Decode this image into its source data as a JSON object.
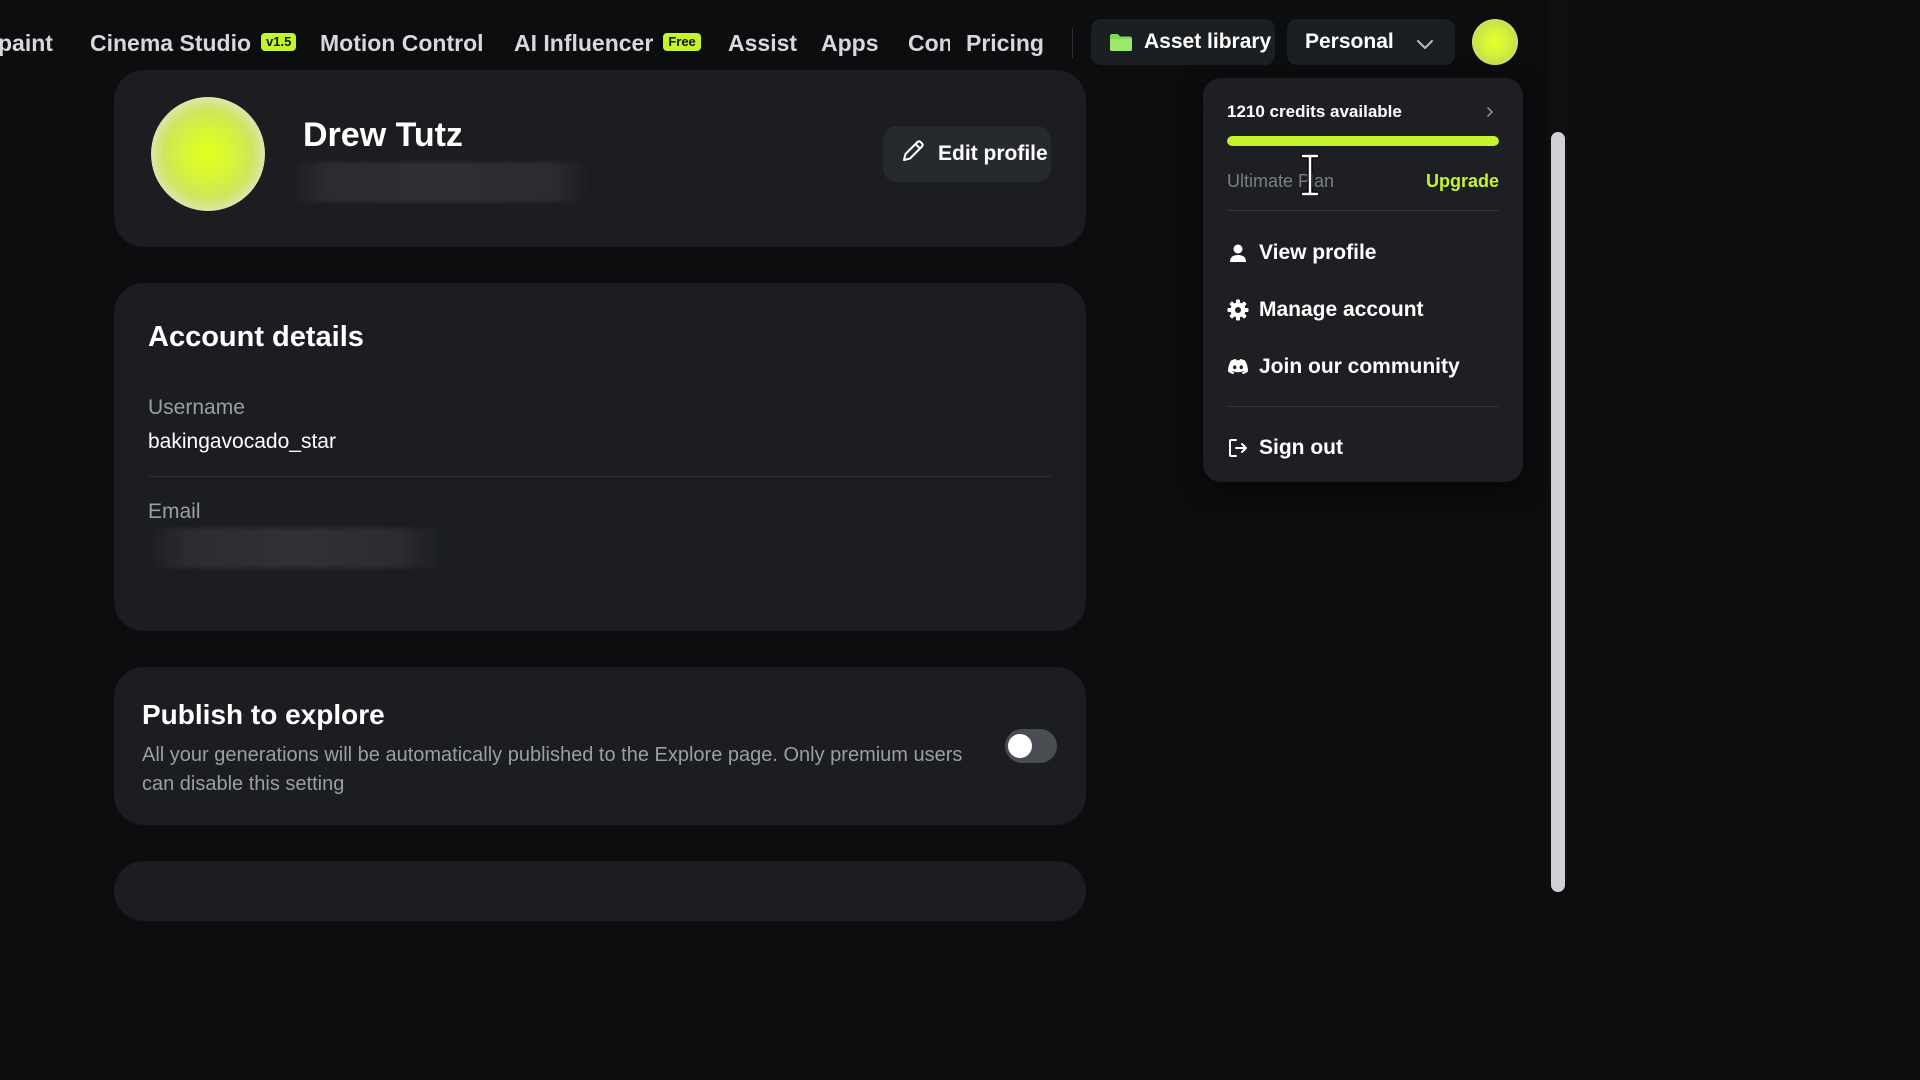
{
  "nav": {
    "items": [
      {
        "label": "paint",
        "badge": ""
      },
      {
        "label": "Cinema Studio",
        "badge": "v1.5"
      },
      {
        "label": "Motion Control",
        "badge": ""
      },
      {
        "label": "AI Influencer",
        "badge": "Free"
      },
      {
        "label": "Assist",
        "badge": ""
      },
      {
        "label": "Apps",
        "badge": ""
      },
      {
        "label": "Con",
        "badge": ""
      },
      {
        "label": "Pricing",
        "badge": ""
      }
    ],
    "asset_library_label": "Asset library",
    "asset_library_icon": "folder-icon",
    "workspace_selected": "Personal"
  },
  "profile": {
    "name": "Drew Tutz",
    "edit_label": "Edit profile"
  },
  "account": {
    "title": "Account details",
    "username_label": "Username",
    "username_value": "bakingavocado_star",
    "email_label": "Email"
  },
  "publish": {
    "title": "Publish to explore",
    "description": "All your generations will be automatically published to the Explore page. Only premium users can disable this setting",
    "enabled": false
  },
  "menu": {
    "credits_text": "1210 credits available",
    "credits_progress": 1.0,
    "plan_label": "Ultimate Plan",
    "upgrade_label": "Upgrade",
    "items": [
      {
        "label": "View profile",
        "icon": "user-icon"
      },
      {
        "label": "Manage account",
        "icon": "gear-icon"
      },
      {
        "label": "Join our community",
        "icon": "discord-icon"
      },
      {
        "label": "Sign out",
        "icon": "sign-out-icon"
      }
    ]
  },
  "colors": {
    "accent": "#c4f52a",
    "background": "#0b0d0f",
    "card": "#1b1d20"
  }
}
